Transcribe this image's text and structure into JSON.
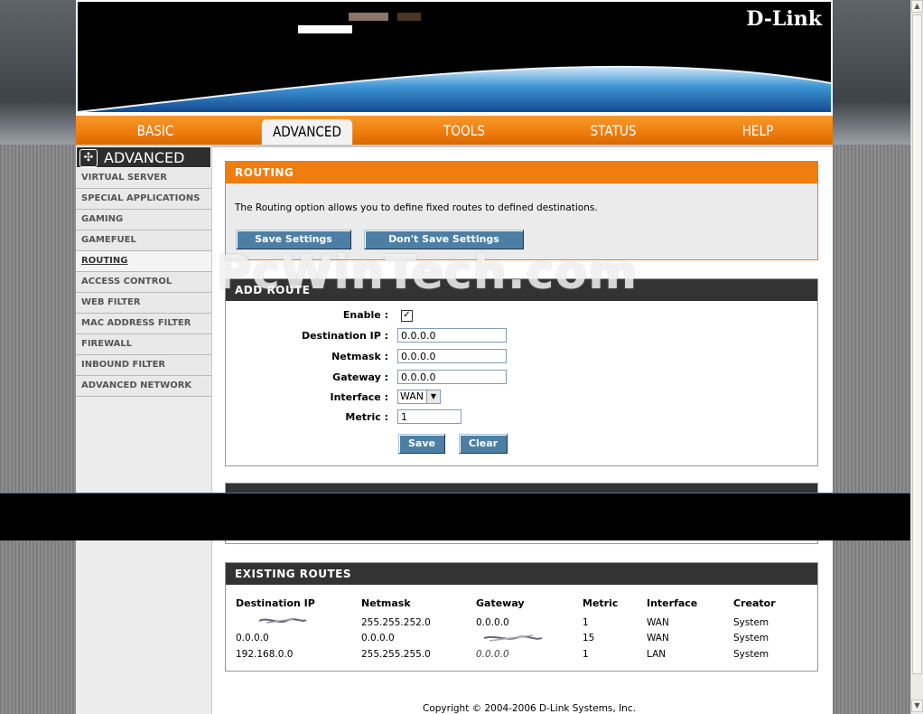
{
  "brand": {
    "logo": "D-Link"
  },
  "nav": {
    "tabs": [
      {
        "label": "BASIC"
      },
      {
        "label": "ADVANCED"
      },
      {
        "label": "TOOLS"
      },
      {
        "label": "STATUS"
      },
      {
        "label": "HELP"
      }
    ]
  },
  "sidebar": {
    "title": "ADVANCED",
    "items": [
      {
        "label": "VIRTUAL SERVER"
      },
      {
        "label": "SPECIAL APPLICATIONS"
      },
      {
        "label": "GAMING"
      },
      {
        "label": "GAMEFUEL"
      },
      {
        "label": "ROUTING"
      },
      {
        "label": "ACCESS CONTROL"
      },
      {
        "label": "WEB FILTER"
      },
      {
        "label": "MAC ADDRESS FILTER"
      },
      {
        "label": "FIREWALL"
      },
      {
        "label": "INBOUND FILTER"
      },
      {
        "label": "ADVANCED NETWORK"
      }
    ]
  },
  "routing": {
    "title": "ROUTING",
    "intro": "The Routing option allows you to define fixed routes to defined destinations.",
    "save_label": "Save Settings",
    "dont_save_label": "Don't Save Settings"
  },
  "add_route": {
    "title": "ADD ROUTE",
    "enable_label": "Enable :",
    "enable_checked": true,
    "dest_ip_label": "Destination IP :",
    "dest_ip_value": "0.0.0.0",
    "netmask_label": "Netmask :",
    "netmask_value": "0.0.0.0",
    "gateway_label": "Gateway :",
    "gateway_value": "0.0.0.0",
    "interface_label": "Interface :",
    "interface_value": "WAN",
    "metric_label": "Metric :",
    "metric_value": "1",
    "save_label": "Save",
    "clear_label": "Clear"
  },
  "existing_routes": {
    "title": "EXISTING ROUTES",
    "headers": [
      "Destination IP",
      "Netmask",
      "Gateway",
      "Metric",
      "Interface",
      "Creator"
    ],
    "rows": [
      {
        "dest": "",
        "mask": "255.255.252.0",
        "gw": "0.0.0.0",
        "metric": "1",
        "iface": "WAN",
        "creator": "System"
      },
      {
        "dest": "0.0.0.0",
        "mask": "0.0.0.0",
        "gw": "",
        "metric": "15",
        "iface": "WAN",
        "creator": "System"
      },
      {
        "dest": "192.168.0.0",
        "mask": "255.255.255.0",
        "gw": "0.0.0.0",
        "metric": "1",
        "iface": "LAN",
        "creator": "System"
      }
    ]
  },
  "footer": {
    "copyright": "Copyright © 2004-2006 D-Link Systems, Inc."
  },
  "watermark": {
    "text": "PcWinTech.com"
  },
  "colors": {
    "orange": "#f07d10",
    "dark": "#333333",
    "button": "#4d7fa5"
  }
}
